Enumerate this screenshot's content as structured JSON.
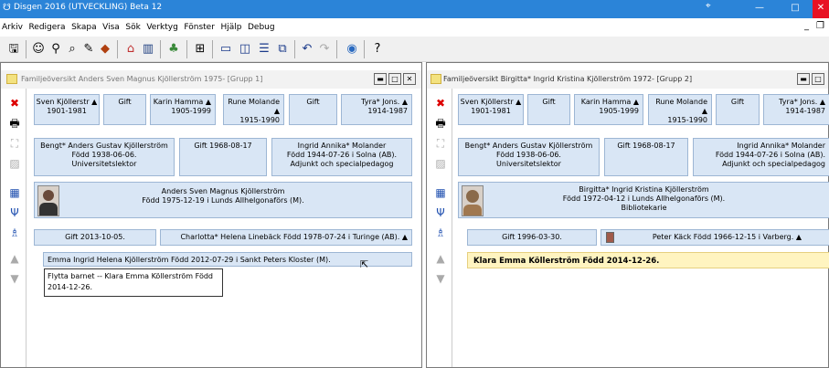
{
  "app": {
    "title": "Disgen 2016 (UTVECKLING) Beta 12"
  },
  "menu": [
    "Arkiv",
    "Redigera",
    "Skapa",
    "Visa",
    "Sök",
    "Verktyg",
    "Fönster",
    "Hjälp",
    "Debug"
  ],
  "left": {
    "title": "Familjeöversikt Anders Sven Magnus Kjöllerström 1975- [Grupp 1]",
    "grandparents": {
      "p1": "Sven Kjöllerstr ▲",
      "p1d": "1901-1981",
      "m1": "Gift",
      "p2": "Karin Hamma ▲",
      "p2d": "1905-1999",
      "p3": "Rune Molande ▲",
      "p3d": "1915-1990",
      "m2": "Gift",
      "p4": "Tyra* Jons. ▲",
      "p4d": "1914-1987"
    },
    "father": {
      "name": "Bengt* Anders Gustav Kjöllerström",
      "born": "Född 1938-06-06.",
      "occ": "Universitetslektor"
    },
    "marriage": "Gift 1968-08-17",
    "mother": {
      "name": "Ingrid Annika* Molander",
      "born": "Född 1944-07-26 i Solna (AB).",
      "occ": "Adjunkt och specialpedagog"
    },
    "main": {
      "name": "Anders Sven Magnus Kjöllerström",
      "born": "Född 1975-12-19 i Lunds Allhelgonaförs (M)."
    },
    "spouse_marriage": "Gift 2013-10-05.",
    "spouse": "Charlotta* Helena Linebäck Född 1978-07-24 i Turinge (AB). ▲",
    "child": "Emma Ingrid Helena Kjöllerström Född 2012-07-29 i Sankt Peters Kloster (M).",
    "tooltip1": "Flytta barnet -- Klara Emma Köllerström Född",
    "tooltip2": "2014-12-26."
  },
  "right": {
    "title": "Familjeöversikt Birgitta* Ingrid Kristina Kjöllerström 1972- [Grupp 2]",
    "grandparents": {
      "p1": "Sven Kjöllerstr ▲",
      "p1d": "1901-1981",
      "m1": "Gift",
      "p2": "Karin Hamma ▲",
      "p2d": "1905-1999",
      "p3": "Rune Molande ▲",
      "p3d": "1915-1990",
      "m2": "Gift",
      "p4": "Tyra* Jons. ▲",
      "p4d": "1914-1987"
    },
    "father": {
      "name": "Bengt* Anders Gustav Kjöllerström",
      "born": "Född 1938-06-06.",
      "occ": "Universitetslektor"
    },
    "marriage": "Gift 1968-08-17",
    "mother": {
      "name": "Ingrid Annika* Molander",
      "born": "Född 1944-07-26 i Solna (AB).",
      "occ": "Adjunkt och specialpedagog"
    },
    "main": {
      "name": "Birgitta* Ingrid Kristina Kjöllerström",
      "born": "Född 1972-04-12 i Lunds Allhelgonaförs (M).",
      "occ": "Bibliotekarie"
    },
    "spouse_marriage": "Gift 1996-03-30.",
    "spouse": "Peter Käck Född 1966-12-15 i Varberg. ▲",
    "child": "Klara Emma Köllerström Född 2014-12-26."
  }
}
